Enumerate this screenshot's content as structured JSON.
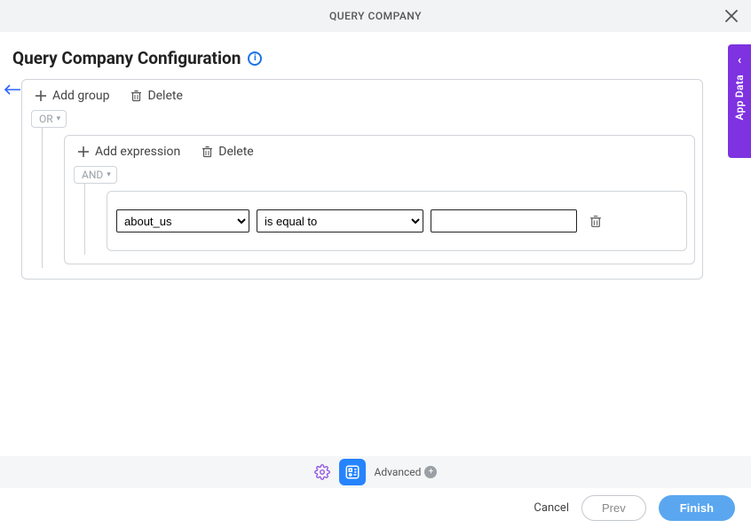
{
  "header": {
    "title": "QUERY COMPANY"
  },
  "page": {
    "title": "Query Company Configuration"
  },
  "sideTab": {
    "label": "App Data"
  },
  "builder": {
    "outer": {
      "addGroupLabel": "Add group",
      "deleteLabel": "Delete",
      "logic": "OR"
    },
    "inner": {
      "addExpressionLabel": "Add expression",
      "deleteLabel": "Delete",
      "logic": "AND"
    },
    "expression": {
      "field": "about_us",
      "operator": "is equal to",
      "value": ""
    }
  },
  "bottomBar": {
    "advancedLabel": "Advanced"
  },
  "footer": {
    "cancel": "Cancel",
    "prev": "Prev",
    "finish": "Finish"
  }
}
